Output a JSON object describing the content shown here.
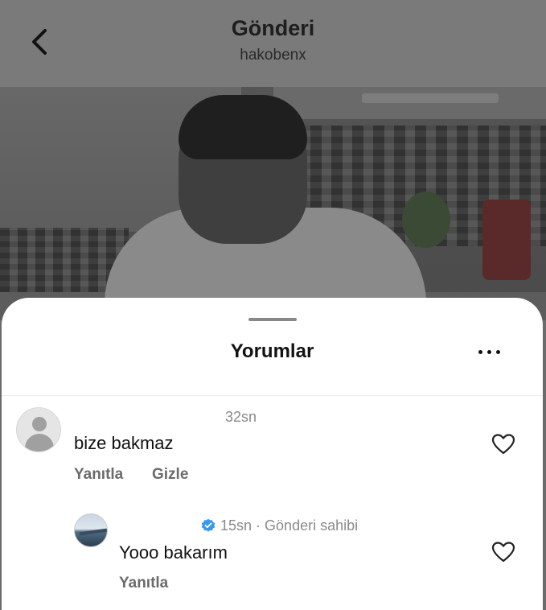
{
  "header": {
    "title": "Gönderi",
    "username": "hakobenx"
  },
  "sheet": {
    "title": "Yorumlar"
  },
  "comments": [
    {
      "time": "32sn",
      "text": "bize bakmaz",
      "reply_label": "Yanıtla",
      "hide_label": "Gizle"
    },
    {
      "time": "15sn",
      "separator": " · ",
      "owner_label": "Gönderi sahibi",
      "text": "Yooo bakarım",
      "reply_label": "Yanıtla",
      "verified": true
    }
  ],
  "icons": {
    "back": "chevron-left-icon",
    "more": "ellipsis-icon",
    "like": "heart-outline-icon",
    "verified": "verified-badge-icon"
  },
  "colors": {
    "verified_blue": "#3897f0",
    "muted_text": "#8a8a8a"
  }
}
